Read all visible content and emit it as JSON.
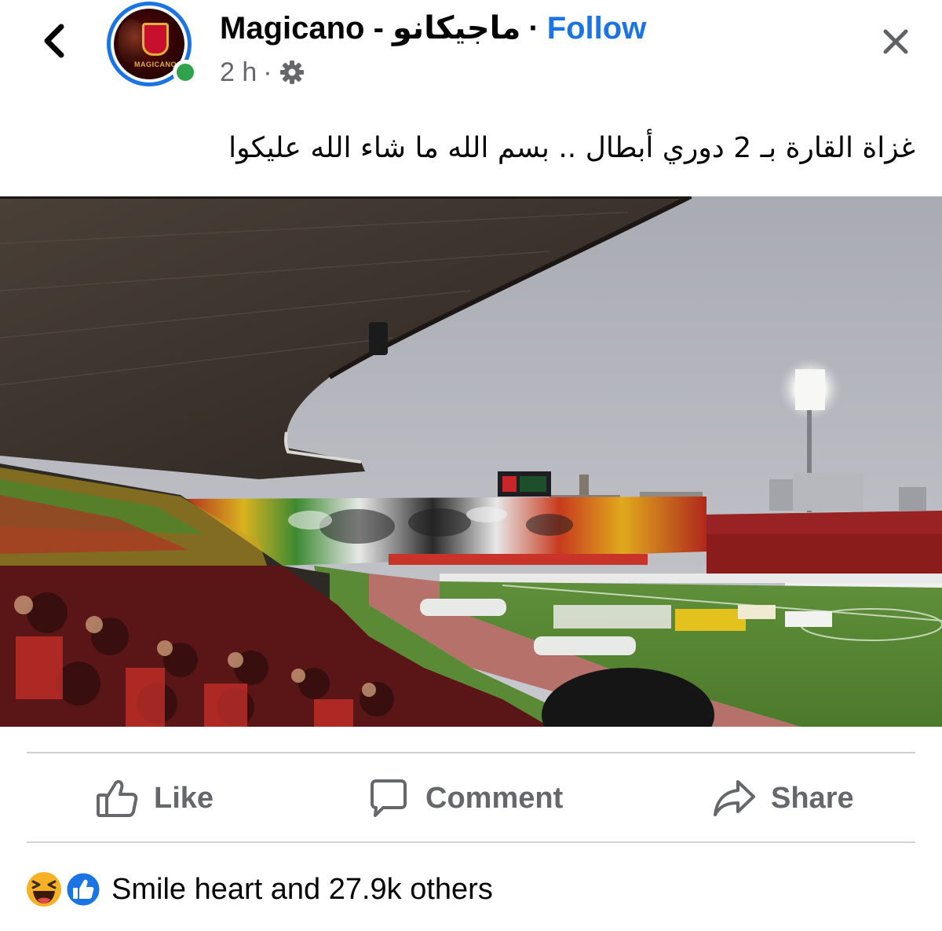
{
  "header": {
    "page_name": "Magicano - ماجيكانو",
    "separator": "·",
    "follow_label": "Follow",
    "timestamp": "2 h",
    "meta_separator": "·",
    "privacy_icon": "gear-icon",
    "back_icon": "chevron-left-icon",
    "close_icon": "close-icon",
    "avatar_logo_text": "MAGICANO"
  },
  "post": {
    "text": "غزاة القارة بـ 2 دوري أبطال .. بسم الله ما شاء الله عليكوا",
    "photo_subject": "stadium"
  },
  "actions": {
    "like_label": "Like",
    "comment_label": "Comment",
    "share_label": "Share"
  },
  "reactions": {
    "summary": "Smile heart and 27.9k others",
    "icons": [
      "haha-icon",
      "like-icon"
    ]
  },
  "colors": {
    "accent": "#1b74e4",
    "online": "#31a24c",
    "secondary_text": "#65676b",
    "divider": "#ced0d4"
  }
}
